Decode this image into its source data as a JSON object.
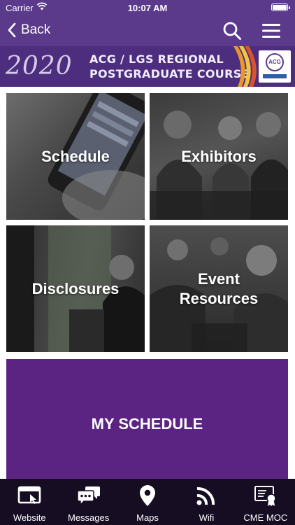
{
  "status_bar": {
    "carrier": "Carrier",
    "time": "10:07 AM"
  },
  "nav": {
    "back_label": "Back"
  },
  "banner": {
    "year": "2020",
    "title_line1": "ACG / LGS REGIONAL",
    "title_line2": "POSTGRADUATE COURSE",
    "logo_text": "ACG"
  },
  "tiles": [
    {
      "label": "Schedule"
    },
    {
      "label": "Exhibitors"
    },
    {
      "label": "Disclosures"
    },
    {
      "label_line1": "Event",
      "label_line2": "Resources"
    }
  ],
  "my_schedule": {
    "label": "MY SCHEDULE"
  },
  "tabbar": {
    "items": [
      {
        "label": "Website",
        "icon": "browser-window-icon"
      },
      {
        "label": "Messages",
        "icon": "chat-bubbles-icon"
      },
      {
        "label": "Maps",
        "icon": "map-pin-icon"
      },
      {
        "label": "Wifi",
        "icon": "wifi-icon"
      },
      {
        "label": "CME MOC",
        "icon": "certificate-icon"
      }
    ]
  },
  "colors": {
    "primary": "#5b3a8c",
    "my_schedule_bg": "#5b2483",
    "tabbar_bg": "#160d22"
  }
}
